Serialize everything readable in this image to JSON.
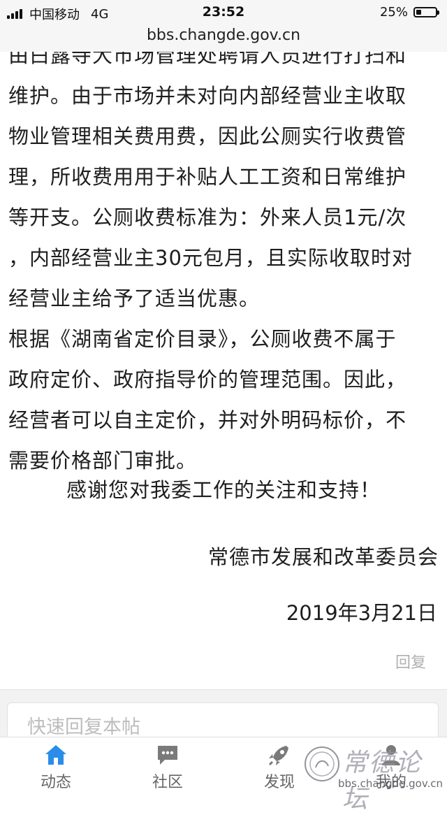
{
  "status_bar": {
    "carrier": "中国移动",
    "network": "4G",
    "time": "23:52",
    "battery_text": "25%",
    "battery_level": 0.25
  },
  "browser": {
    "url": "bbs.changde.gov.cn"
  },
  "post": {
    "lines_top": [
      "由白露寺大市场管理处聘请人员进行打扫和",
      "维护。由于市场并未对向内部经营业主收取",
      "物业管理相关费用费，因此公厕实行收费管",
      "理，所收费用用于补贴人工工资和日常维护",
      "等开支。公厕收费标准为：外来人员1元/次",
      "，内部经营业主30元包月，且实际收取时对",
      "经营业主给予了适当优惠。"
    ],
    "lines_second": [
      "根据《湖南省定价目录》，公厕收费不属于",
      "政府定价、政府指导价的管理范围。因此，",
      "经营者可以自主定价，并对外明码标价，不",
      "需要价格部门审批。"
    ],
    "thanks": "感谢您对我委工作的关注和支持！",
    "organization": "常德市发展和改革委员会",
    "date": "2019年3月21日",
    "reply_label": "回复"
  },
  "quick_reply": {
    "placeholder": "快速回复本帖"
  },
  "tab_bar": {
    "tabs": [
      {
        "label": "动态",
        "icon": "home-icon",
        "active": true
      },
      {
        "label": "社区",
        "icon": "chat-icon",
        "active": false
      },
      {
        "label": "发现",
        "icon": "rocket-icon",
        "active": false
      },
      {
        "label": "我的",
        "icon": "user-icon",
        "active": false
      }
    ]
  },
  "watermark": {
    "title": "常德论坛",
    "url": "bbs.changde.gov.cn"
  },
  "colors": {
    "accent": "#2a8de8",
    "text": "#1e1e1e",
    "muted": "#b0b0b0"
  }
}
